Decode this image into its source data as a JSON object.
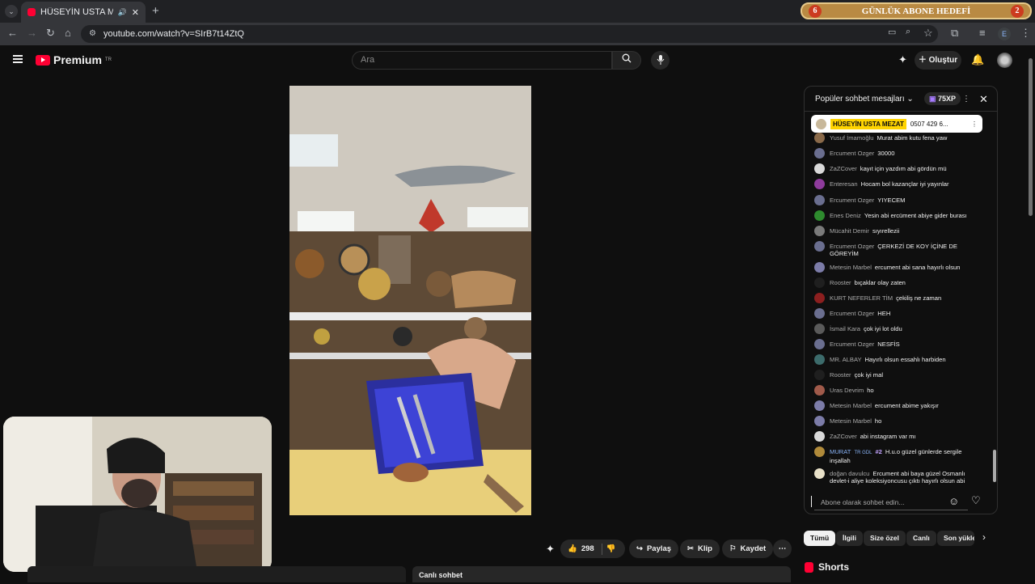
{
  "browser": {
    "tab_title": "HÜSEYİN USTA MEZAT kanal",
    "url": "youtube.com/watch?v=SIrB7t14ZtQ",
    "goal_banner": {
      "left_number": "6",
      "title": "GÜNLÜK ABONE HEDEFİ",
      "right_number": "2"
    },
    "profile_initial": "E"
  },
  "header": {
    "logo_text": "Premium",
    "logo_superscript": "TR",
    "search_placeholder": "Ara",
    "create_label": "Oluştur"
  },
  "actions": {
    "like_count": "298",
    "share_label": "Paylaş",
    "clip_label": "Klip",
    "save_label": "Kaydet"
  },
  "bottom": {
    "live_chat_label": "Canlı sohbet",
    "shorts_label": "Shorts"
  },
  "chat": {
    "header_title": "Popüler sohbet mesajları",
    "xp_label": "75XP",
    "pinned": {
      "author": "HÜSEYİN USTA MEZAT",
      "text": "0507 429 6..."
    },
    "input_placeholder": "Abone olarak sohbet edin...",
    "messages": [
      {
        "author": "Yusuf İmamoğlu",
        "text": "Murat abim kutu fena yaw",
        "color": "#8a6a4a"
      },
      {
        "author": "Ercument Ozger",
        "text": "30000",
        "color": "#6a6e8f"
      },
      {
        "author": "ZaZCover",
        "text": "kayıt için yazdım abi gördün mü",
        "color": "#d9d9d9"
      },
      {
        "author": "Enteresan",
        "text": "Hocam bol kazançlar iyi yayınlar",
        "color": "#8e3b9c"
      },
      {
        "author": "Ercument Ozger",
        "text": "YIYECEM",
        "color": "#6a6e8f"
      },
      {
        "author": "Enes Deniz",
        "text": "Yesin abi ercüment abiye gider burası",
        "color": "#2e8b2e"
      },
      {
        "author": "Mücahit Demir",
        "text": "sıyırellezii",
        "color": "#7a7a7a"
      },
      {
        "author": "Ercument Ozger",
        "text": "ÇERKEZİ DE KOY İÇİNE DE GÖREYİM",
        "color": "#6a6e8f"
      },
      {
        "author": "Metesin Marbel",
        "text": "ercument abi sana hayırlı olsun",
        "color": "#7c7ca8"
      },
      {
        "author": "Rooster",
        "text": "bıçaklar olay zaten",
        "color": "#1f1f1f"
      },
      {
        "author": "KURT NEFERLER TİM",
        "text": "çekiliş ne zaman",
        "color": "#8c1f1f"
      },
      {
        "author": "Ercument Ozger",
        "text": "HEH",
        "color": "#6a6e8f"
      },
      {
        "author": "İsmail Kara",
        "text": "çok iyi lot oldu",
        "color": "#5a5a5a"
      },
      {
        "author": "Ercument Ozger",
        "text": "NESFİS",
        "color": "#6a6e8f"
      },
      {
        "author": "MR. ALBAY",
        "text": "Hayırlı olsun essahlı harbiden",
        "color": "#3c6b6b"
      },
      {
        "author": "Rooster",
        "text": "çok iyi mal",
        "color": "#1f1f1f"
      },
      {
        "author": "Uras Devrim",
        "text": "ho",
        "color": "#a05a4a"
      },
      {
        "author": "Metesin Marbel",
        "text": "ercument abime yakışır",
        "color": "#7c7ca8"
      },
      {
        "author": "Metesin Marbel",
        "text": "ho",
        "color": "#7c7ca8"
      },
      {
        "author": "ZaZCover",
        "text": "abi instagram var mı",
        "color": "#d9d9d9"
      },
      {
        "author": "MURAT",
        "text": "H.u.o güzel günlerde sergile inşallah",
        "color": "#b08a3a"
      },
      {
        "author": "doğan davulcu",
        "text": "Ercument abi baya güzel Osmanlı devlet-i aliye koleksiyoncusu çıktı hayırlı olsun abi",
        "color": "#e8e0c8"
      }
    ],
    "murat_badge": "TR GDL",
    "murat_rank": "#2"
  },
  "chips": [
    "Tümü",
    "İlgili",
    "Size özel",
    "Canlı",
    "Son yükle"
  ],
  "colors": {
    "accent": "#ff0033",
    "pinned_badge": "#ffd400",
    "member_name": "#8ab4f8"
  }
}
